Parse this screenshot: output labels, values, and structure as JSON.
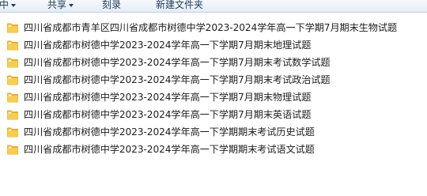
{
  "toolbar": {
    "items": [
      {
        "label": "中",
        "has_dropdown": true
      },
      {
        "label": "共享",
        "has_dropdown": true
      },
      {
        "label": "刻录",
        "has_dropdown": false
      },
      {
        "label": "新建文件夹",
        "has_dropdown": false
      }
    ]
  },
  "files": [
    {
      "name": "四川省成都市青羊区四川省成都市树德中学2023-2024学年高一下学期7月期末生物试题",
      "icon": "folder-icon"
    },
    {
      "name": "四川省成都市树德中学2023-2024学年高一下学期7月期末地理试题",
      "icon": "folder-icon"
    },
    {
      "name": "四川省成都市树德中学2023-2024学年高一下学期7月期末考试数学试题",
      "icon": "folder-icon"
    },
    {
      "name": "四川省成都市树德中学2023-2024学年高一下学期7月期末考试政治试题",
      "icon": "folder-icon"
    },
    {
      "name": "四川省成都市树德中学2023-2024学年高一下学期7月期末物理试题",
      "icon": "folder-icon"
    },
    {
      "name": "四川省成都市树德中学2023-2024学年高一下学期7月期末英语试题",
      "icon": "folder-icon"
    },
    {
      "name": "四川省成都市树德中学2023-2024学年高一下学期期末考试历史试题",
      "icon": "folder-icon"
    },
    {
      "name": "四川省成都市树德中学2023-2024学年高一下学期期末考试语文试题",
      "icon": "folder-icon"
    }
  ],
  "colors": {
    "toolbar_bg": "#e9eff7",
    "folder_yellow": "#f3c33f",
    "text": "#1e1e1e"
  }
}
